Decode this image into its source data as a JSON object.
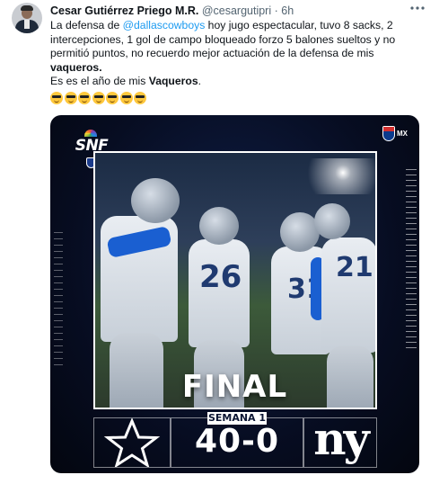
{
  "tweet": {
    "author_name": "Cesar Gutiérrez Priego M.R.",
    "author_handle": "@cesargutipri",
    "separator": "·",
    "timestamp": "6h",
    "more_icon": "more-dots-icon",
    "text": {
      "line1_a": "La defensa de ",
      "mention": "@dallascowboys",
      "line1_b": " hoy jugo espectacular, tuvo 8 sacks, 2 intercepciones, 1 gol de campo bloqueado  forzo 5 balones sueltos y no permitió puntos, no recuerdo mejor actuación de la defensa de mis ",
      "bold1": "vaqueros.",
      "line2_a": "Es es el año de mis ",
      "bold2": "Vaqueros",
      "line2_b": "."
    },
    "emoji_name": "smiling-face-with-sunglasses",
    "emoji_count": 7
  },
  "media": {
    "network_logo": "SNF",
    "league_badge": "MX",
    "final_label": "FINAL",
    "week_label": "SEMANA 1",
    "score": "40-0",
    "away_team_logo": "star-logo",
    "home_team_logo": "ny",
    "jersey_numbers": [
      "26",
      "31",
      "21"
    ]
  },
  "colors": {
    "accent_link": "#1d9bf0",
    "text_primary": "#0f1419",
    "text_secondary": "#536471",
    "graphic_background": "#070d22"
  }
}
